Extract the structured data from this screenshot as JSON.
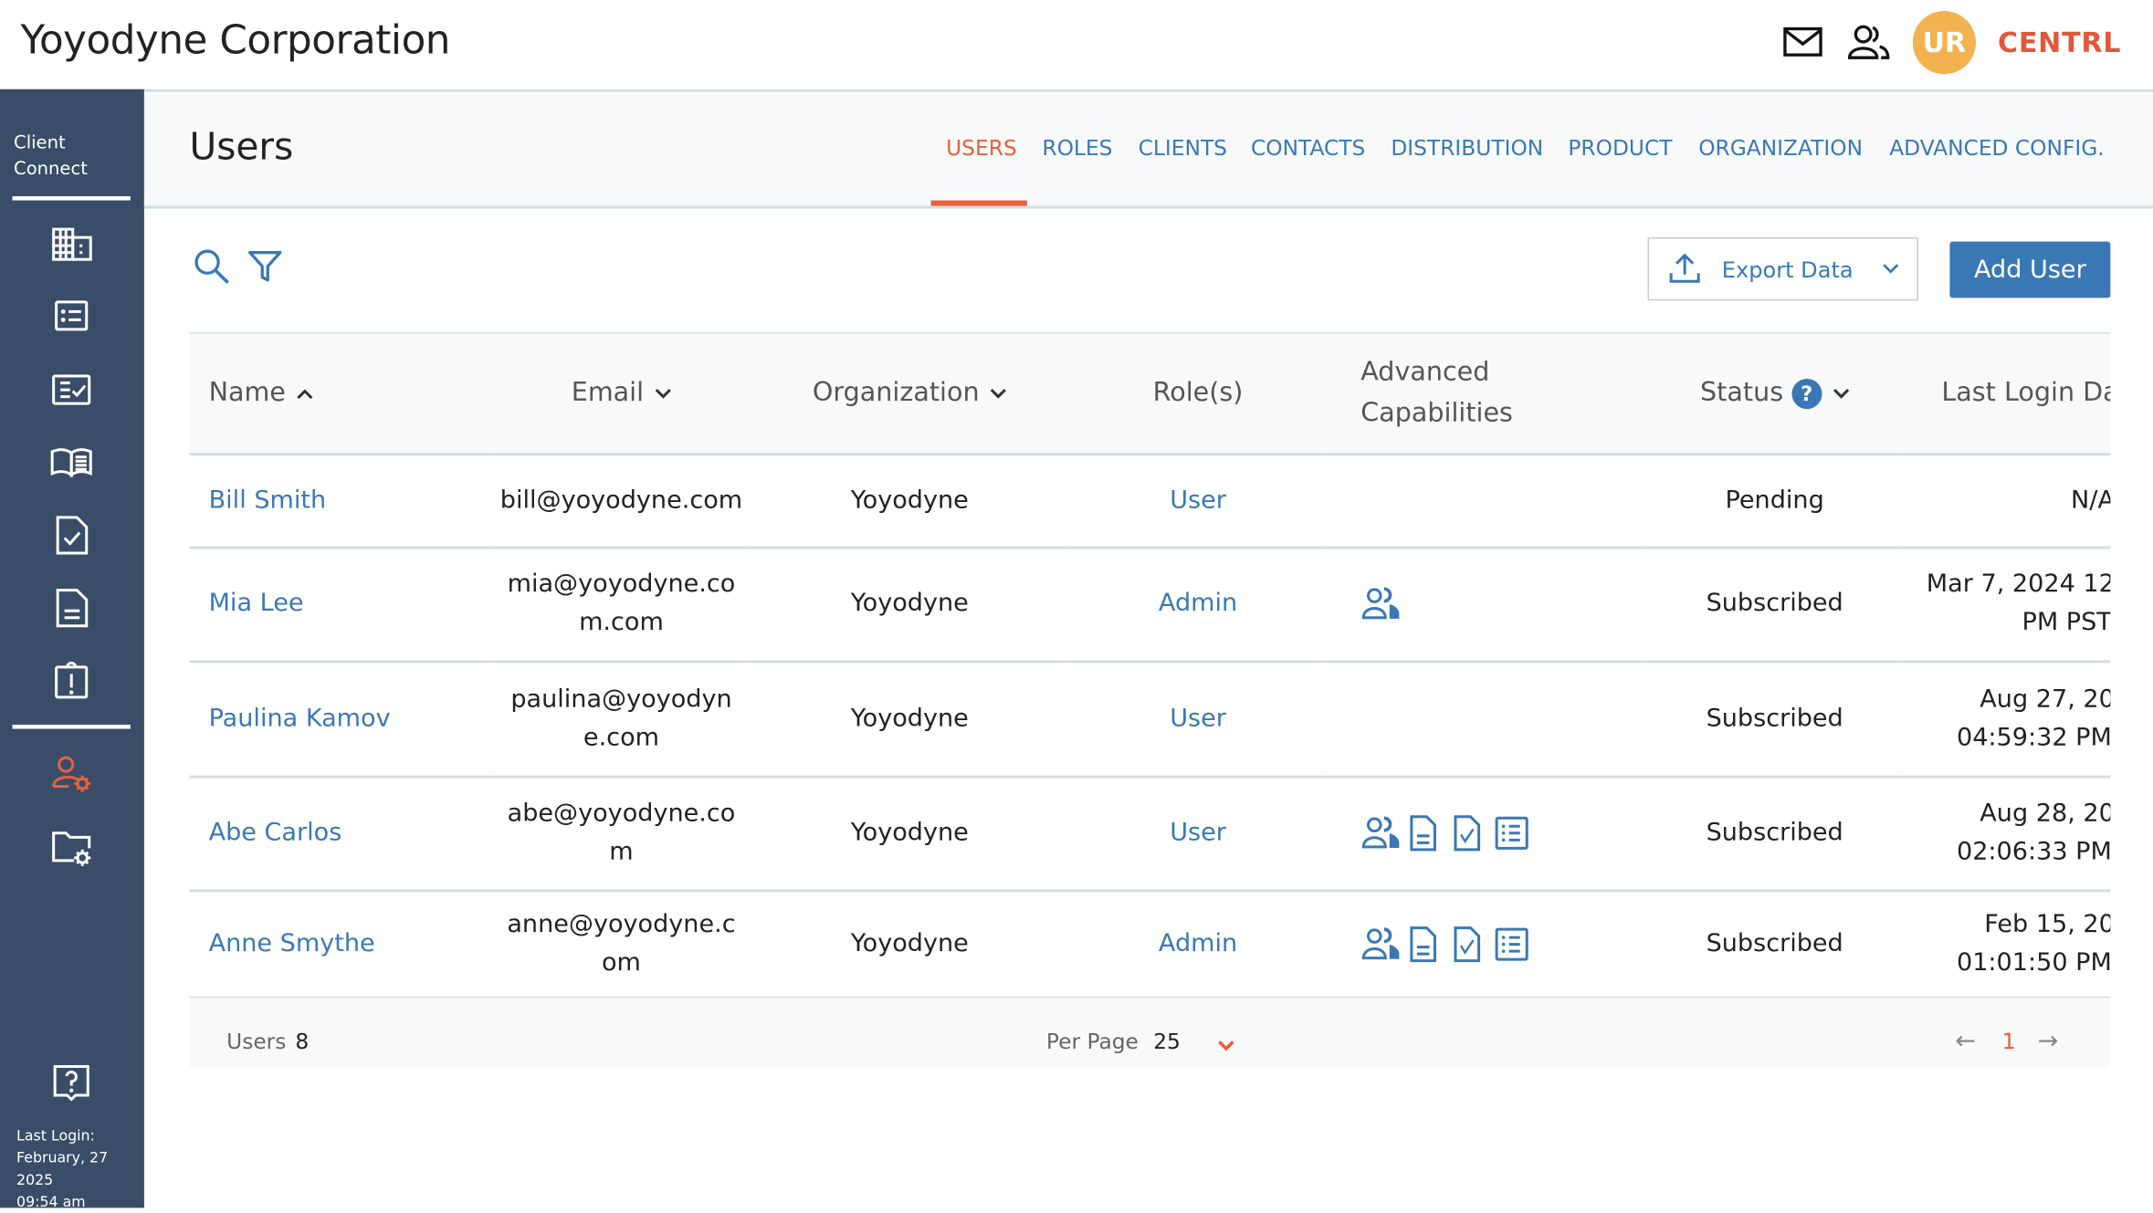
{
  "header": {
    "company": "Yoyodyne Corporation",
    "avatar_initials": "UR",
    "brand": "CENTRL",
    "icons": [
      "mail-icon",
      "users-icon"
    ]
  },
  "sidebar": {
    "title_line1": "Client",
    "title_line2": "Connect",
    "items": [
      "building-icon",
      "list-icon",
      "checklist-icon",
      "book-icon",
      "document-check-icon",
      "document-icon",
      "alert-icon",
      "user-settings-icon",
      "folder-settings-icon",
      "help-icon"
    ],
    "active": "user-settings-icon",
    "last_login_label": "Last Login:",
    "last_login_date": "February, 27 2025",
    "last_login_time": "09:54 am"
  },
  "page": {
    "title": "Users"
  },
  "tabs": [
    {
      "label": "USERS",
      "active": true
    },
    {
      "label": "ROLES"
    },
    {
      "label": "CLIENTS"
    },
    {
      "label": "CONTACTS"
    },
    {
      "label": "DISTRIBUTION"
    },
    {
      "label": "PRODUCT"
    },
    {
      "label": "ORGANIZATION"
    },
    {
      "label": "ADVANCED CONFIG."
    }
  ],
  "toolbar": {
    "export_label": "Export Data",
    "add_label": "Add User"
  },
  "table": {
    "columns": {
      "name": "Name",
      "email": "Email",
      "organization": "Organization",
      "roles": "Role(s)",
      "adv_line1": "Advanced",
      "adv_line2": "Capabilities",
      "status": "Status",
      "last_login": "Last Login Da"
    },
    "rows": [
      {
        "name": "Bill Smith",
        "email": "bill@yoyodyne.com",
        "org": "Yoyodyne",
        "role": "User",
        "adv": [],
        "status": "Pending",
        "last1": "N/A",
        "last2": ""
      },
      {
        "name": "Mia Lee",
        "email": "mia@yoyodyne.com.com",
        "org": "Yoyodyne",
        "role": "Admin",
        "adv": [
          "users"
        ],
        "status": "Subscribed",
        "last1": "Mar 7, 2024 12",
        "last2": "PM PST"
      },
      {
        "name": "Paulina Kamov",
        "email": "paulina@yoyodyne.com",
        "org": "Yoyodyne",
        "role": "User",
        "adv": [],
        "status": "Subscribed",
        "last1": "Aug 27, 20",
        "last2": "04:59:32 PM"
      },
      {
        "name": "Abe Carlos",
        "email": "abe@yoyodyne.com",
        "org": "Yoyodyne",
        "role": "User",
        "adv": [
          "users",
          "document",
          "document-check",
          "list"
        ],
        "status": "Subscribed",
        "last1": "Aug 28, 20",
        "last2": "02:06:33 PM"
      },
      {
        "name": "Anne Smythe",
        "email": "anne@yoyodyne.com",
        "org": "Yoyodyne",
        "role": "Admin",
        "adv": [
          "users",
          "document",
          "document-check",
          "list"
        ],
        "status": "Subscribed",
        "last1": "Feb 15, 20",
        "last2": "01:01:50 PM"
      }
    ]
  },
  "footer": {
    "users_label": "Users",
    "users_count": "8",
    "per_page_label": "Per Page",
    "per_page_value": "25",
    "current_page": "1"
  },
  "colors": {
    "sidebar": "#394d68",
    "accent": "#e8603c",
    "link": "#3a78b5",
    "avatar": "#f2b24f"
  }
}
